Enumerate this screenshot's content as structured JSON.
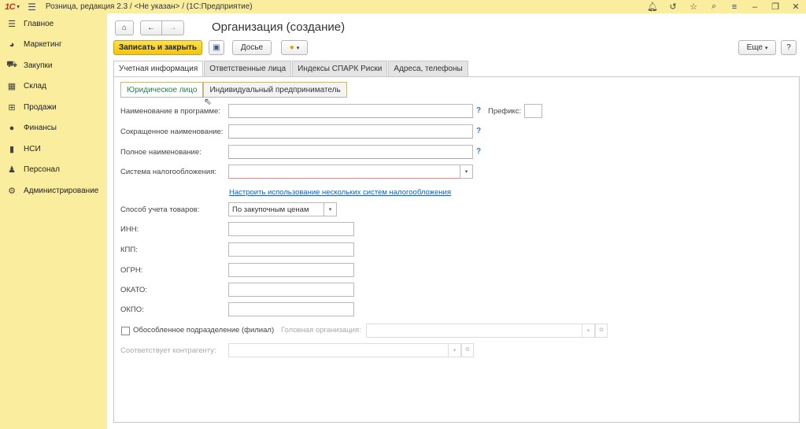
{
  "topbar": {
    "logo": "1С",
    "app_title": "Розница, редакция 2.3 / <Не указан> / (1С:Предприятие)"
  },
  "sidebar": {
    "items": [
      {
        "label": "Главное",
        "icon": "hamburger-icon"
      },
      {
        "label": "Маркетинг",
        "icon": "target-icon"
      },
      {
        "label": "Закупки",
        "icon": "truck-icon"
      },
      {
        "label": "Склад",
        "icon": "warehouse-icon"
      },
      {
        "label": "Продажи",
        "icon": "basket-icon"
      },
      {
        "label": "Финансы",
        "icon": "coin-icon"
      },
      {
        "label": "НСИ",
        "icon": "book-icon"
      },
      {
        "label": "Персонал",
        "icon": "person-icon"
      },
      {
        "label": "Администрирование",
        "icon": "gear-icon"
      }
    ]
  },
  "header": {
    "title": "Организация (создание)"
  },
  "toolbar": {
    "save_close": "Записать и закрыть",
    "dossier": "Досье",
    "more": "Еще",
    "help": "?"
  },
  "tabs": [
    {
      "label": "Учетная информация",
      "active": true
    },
    {
      "label": "Ответственные лица",
      "active": false
    },
    {
      "label": "Индексы СПАРК Риски",
      "active": false
    },
    {
      "label": "Адреса, телефоны",
      "active": false
    }
  ],
  "subtabs": [
    {
      "label": "Юридическое лицо",
      "active": true
    },
    {
      "label": "Индивидуальный предприниматель",
      "active": false
    }
  ],
  "form": {
    "name_in_program_label": "Наименование в программе:",
    "prefix_label": "Префикс:",
    "short_name_label": "Сокращенное наименование:",
    "full_name_label": "Полное наименование:",
    "tax_system_label": "Система налогообложения:",
    "tax_link": "Настроить использование нескольких систем налогообложения",
    "goods_accounting_label": "Способ учета товаров:",
    "goods_accounting_value": "По закупочным ценам",
    "inn_label": "ИНН:",
    "kpp_label": "КПП:",
    "ogrn_label": "ОГРН:",
    "okato_label": "ОКАТО:",
    "okpo_label": "ОКПО:",
    "branch_label": "Обособленное подразделение (филиал)",
    "head_org_label": "Головная организация:",
    "counterparty_label": "Соответствует контрагенту:",
    "help_mark": "?"
  }
}
